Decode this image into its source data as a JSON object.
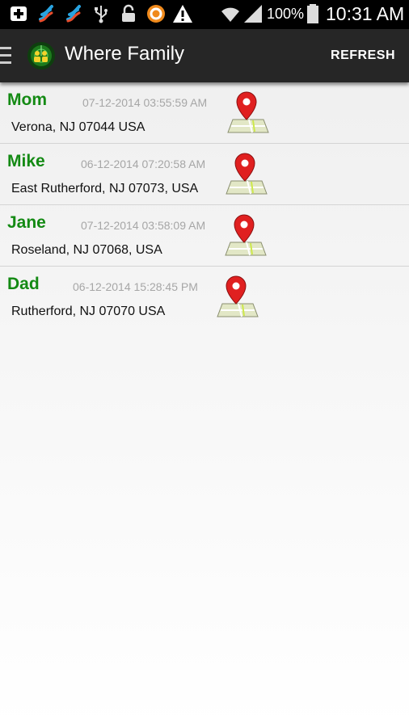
{
  "status_bar": {
    "battery_text": "100%",
    "clock": "10:31 AM",
    "icons": [
      "add-box-icon",
      "app-notification-icon",
      "app-notification-icon",
      "usb-icon",
      "lock-icon",
      "circle-app-icon",
      "warning-icon",
      "wifi-icon",
      "signal-icon",
      "battery-icon"
    ]
  },
  "header": {
    "title": "Where Family",
    "refresh_label": "REFRESH",
    "icons": [
      "menu-drawer-icon",
      "family-radar-logo-icon"
    ]
  },
  "members": [
    {
      "name": "Mom",
      "timestamp": "07-12-2014 03:55:59 AM",
      "address": "Verona, NJ 07044 USA"
    },
    {
      "name": "Mike",
      "timestamp": "06-12-2014 07:20:58 AM",
      "address": "East Rutherford, NJ 07073, USA"
    },
    {
      "name": "Jane",
      "timestamp": "07-12-2014 03:58:09 AM",
      "address": "Roseland, NJ 07068, USA"
    },
    {
      "name": "Dad",
      "timestamp": "06-12-2014 15:28:45 PM",
      "address": "Rutherford, NJ 07070 USA"
    }
  ],
  "colors": {
    "name_green": "#148a14",
    "pin_red": "#e02020",
    "action_bar": "#262626"
  }
}
